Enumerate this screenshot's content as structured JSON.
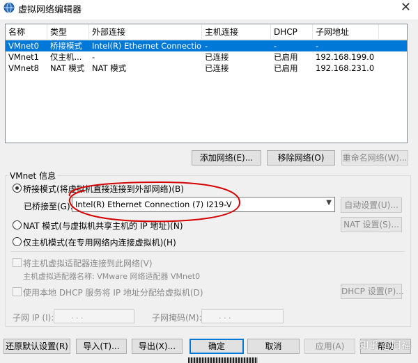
{
  "window": {
    "title": "虚拟网络编辑器",
    "close_glyph": "✕"
  },
  "table": {
    "columns": [
      "名称",
      "类型",
      "外部连接",
      "主机连接",
      "DHCP",
      "子网地址"
    ],
    "rows": [
      [
        "VMnet0",
        "桥接模式",
        "Intel(R) Ethernet Connectio...",
        "-",
        "-",
        "-"
      ],
      [
        "VMnet1",
        "仅主机...",
        "-",
        "已连接",
        "已启用",
        "192.168.199.0"
      ],
      [
        "VMnet8",
        "NAT 模式",
        "NAT 模式",
        "已连接",
        "已启用",
        "192.168.231.0"
      ]
    ],
    "selected_row": 0
  },
  "buttons": {
    "add_network": "添加网络(E)...",
    "remove_network": "移除网络(O)",
    "rename_network": "重命名网络(W)..."
  },
  "vmnet_info": {
    "group_label": "VMnet 信息",
    "bridged_label": "桥接模式(将虚拟机直接连接到外部网络)(B)",
    "bridged_to_label": "已桥接至(G):",
    "bridged_to_value": "Intel(R) Ethernet Connection (7) I219-V",
    "auto_settings": "自动设置(U)...",
    "nat_label": "NAT 模式(与虚拟机共享主机的 IP 地址)(N)",
    "nat_settings": "NAT 设置(S)...",
    "hostonly_label": "仅主机模式(在专用网络内连接虚拟机)(H)",
    "connect_adapter_label": "将主机虚拟适配器连接到此网络(V)",
    "adapter_name_label": "主机虚拟适配器名称: VMware 网络适配器 VMnet0",
    "dhcp_label": "使用本地 DHCP 服务将 IP 地址分配给虚拟机(D)",
    "dhcp_settings": "DHCP 设置(P)...",
    "subnet_ip_label": "子网 IP (I):",
    "subnet_mask_label": "子网掩码(M):",
    "ip_dots": ". . ."
  },
  "footer": {
    "restore_defaults": "还原默认设置(R)",
    "import": "导入(T)...",
    "export": "导出(X)...",
    "ok": "确定",
    "cancel": "取消",
    "apply": "应用(A)",
    "help": "帮助"
  },
  "watermark": "知乎 @阿福",
  "colors": {
    "selection": "#0078d7",
    "annotation": "#d40000",
    "dialog_bg": "#f0f0f0"
  }
}
